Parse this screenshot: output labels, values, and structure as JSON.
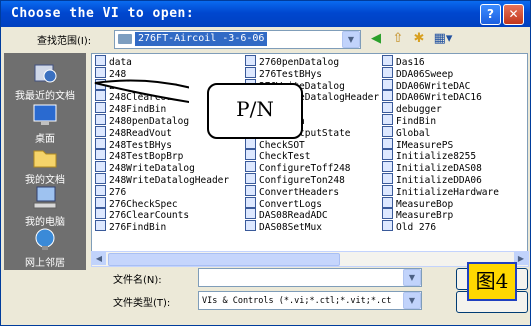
{
  "window": {
    "title": "Choose the VI to open:",
    "help_glyph": "?",
    "close_glyph": "✕"
  },
  "lookin": {
    "label": "查找范围(I):",
    "value": "276FT-Aircoil -3-6-06",
    "views_glyph": "▦▾"
  },
  "places": [
    {
      "label": "我最近的文档",
      "icon": "recent-documents-icon"
    },
    {
      "label": "桌面",
      "icon": "desktop-icon"
    },
    {
      "label": "我的文档",
      "icon": "my-documents-icon"
    },
    {
      "label": "我的电脑",
      "icon": "my-computer-icon"
    },
    {
      "label": "网上邻居",
      "icon": "network-places-icon"
    }
  ],
  "files": {
    "col1": [
      "data",
      "248",
      "248CheckSpec",
      "248ClearCounts",
      "248FindBin",
      "2480penDatalog",
      "248ReadVout",
      "248TestBHys",
      "248TestBopBrp",
      "248WriteDatalog",
      "248WriteDatalogHeader",
      "276",
      "276CheckSpec",
      "276ClearCounts",
      "276FindBin"
    ],
    "col2": [
      "2760penDatalog",
      "276TestBHys",
      "276WriteDatalog",
      "276WriteDatalogHeader",
      "BinCalc",
      "CheckBin",
      "CheckOutputState",
      "CheckSOT",
      "CheckTest",
      "ConfigureToff248",
      "ConfigureTon248",
      "ConvertHeaders",
      "ConvertLogs",
      "DAS08ReadADC",
      "DAS08SetMux"
    ],
    "col3": [
      "Das16",
      "DDA06Sweep",
      "DDA06WriteDAC",
      "DDA06WriteDAC16",
      "debugger",
      "FindBin",
      "Global",
      "IMeasurePS",
      "Initialize8255",
      "InitializeDAS08",
      "InitializeDDA06",
      "InitializeHardware",
      "MeasureBop",
      "MeasureBrp",
      "Old 276"
    ]
  },
  "filename": {
    "label": "文件名(N):",
    "value": ""
  },
  "filetype": {
    "label": "文件类型(T):",
    "value": "VIs & Controls (*.vi;*.ctl;*.vit;*.ct"
  },
  "annotations": {
    "callout": "P/N",
    "figure_label": "图4"
  }
}
